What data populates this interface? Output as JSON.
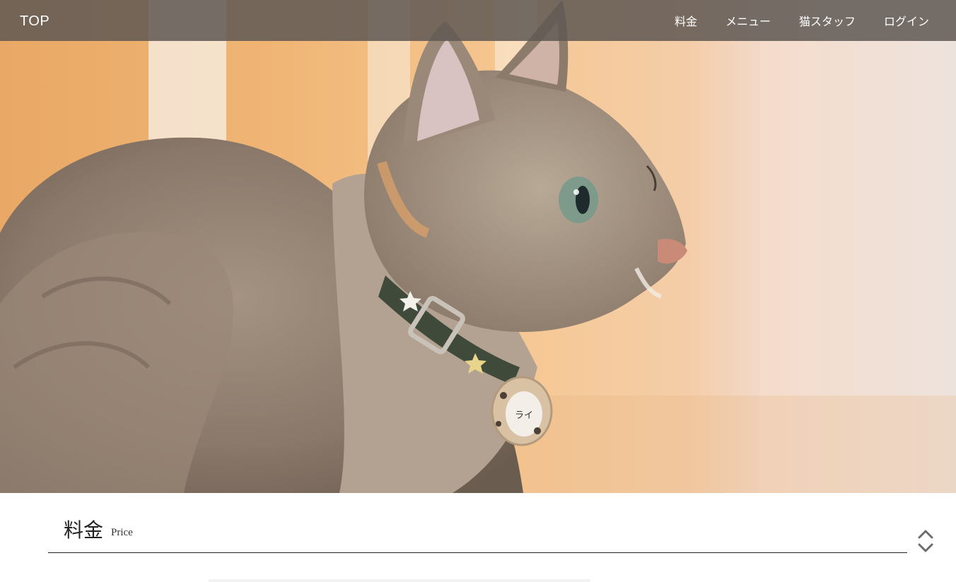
{
  "header": {
    "brand": "TOP",
    "nav": [
      {
        "label": "料金"
      },
      {
        "label": "メニュー"
      },
      {
        "label": "猫スタッフ"
      },
      {
        "label": "ログイン"
      }
    ]
  },
  "hero": {
    "name_tag": "ライ"
  },
  "section": {
    "title": "料金",
    "subtitle": "Price"
  },
  "icons": {
    "scroll": "chevron-up-down-icon"
  },
  "colors": {
    "header_bg": "#605854",
    "header_text": "#ffffff",
    "heading_text": "#222222",
    "rule": "#222222"
  }
}
